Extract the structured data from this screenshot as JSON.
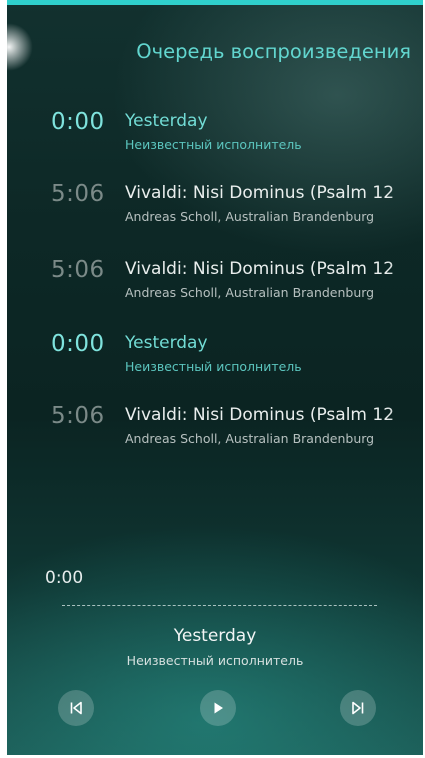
{
  "header": {
    "title": "Очередь воспроизведения"
  },
  "queue": [
    {
      "duration": "0:00",
      "title": "Yesterday",
      "artist": "Неизвестный исполнитель",
      "active": true
    },
    {
      "duration": "5:06",
      "title": "Vivaldi: Nisi Dominus (Psalm 12",
      "artist": "Andreas Scholl, Australian Brandenburg",
      "active": false
    },
    {
      "duration": "5:06",
      "title": "Vivaldi: Nisi Dominus (Psalm 12",
      "artist": "Andreas Scholl, Australian Brandenburg",
      "active": false
    },
    {
      "duration": "0:00",
      "title": "Yesterday",
      "artist": "Неизвестный исполнитель",
      "active": true
    },
    {
      "duration": "5:06",
      "title": "Vivaldi: Nisi Dominus (Psalm 12",
      "artist": "Andreas Scholl, Australian Brandenburg",
      "active": false
    }
  ],
  "player": {
    "current_time": "0:00",
    "title": "Yesterday",
    "artist": "Неизвестный исполнитель",
    "controls": {
      "prev_icon": "skip-previous-icon",
      "play_icon": "play-icon",
      "next_icon": "skip-next-icon"
    }
  },
  "colors": {
    "accent": "#2fd0cc",
    "active_text": "#72dcd5",
    "inactive_duration": "#7b8a88"
  }
}
